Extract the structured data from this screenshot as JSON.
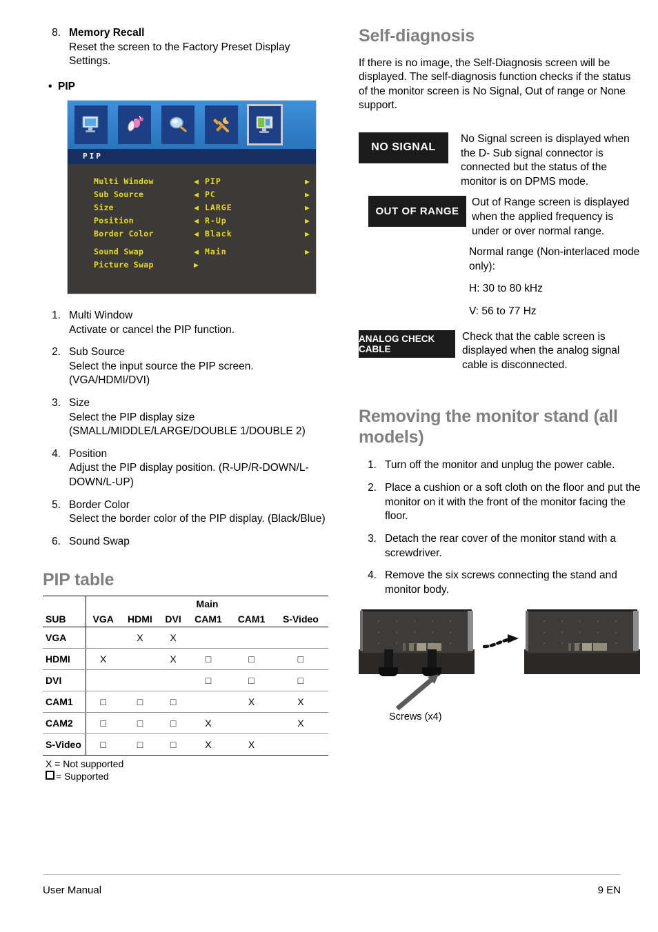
{
  "left_column": {
    "item8": {
      "number": "8.",
      "title": "Memory Recall",
      "desc": "Reset the screen to the Factory Preset Display Settings."
    },
    "bullet_pip": "PIP",
    "osd": {
      "menu_title": "PIP",
      "icons": [
        "display-monitor-icon",
        "color-paint-icon",
        "magnifier-icon",
        "wrench-tools-icon",
        "pip-picture-icon"
      ],
      "selected_icon_index": 4,
      "arrow_left": "◀",
      "arrow_right": "▶",
      "rows": [
        {
          "label": "Multi Window",
          "value": "PIP",
          "left_arrow": true,
          "right_arrow": true
        },
        {
          "label": "Sub Source",
          "value": "PC",
          "left_arrow": true,
          "right_arrow": true
        },
        {
          "label": "Size",
          "value": "LARGE",
          "left_arrow": true,
          "right_arrow": true
        },
        {
          "label": "Position",
          "value": "R-Up",
          "left_arrow": true,
          "right_arrow": true
        },
        {
          "label": "Border Color",
          "value": "Black",
          "left_arrow": true,
          "right_arrow": true
        },
        {
          "label": "Sound Swap",
          "value": "Main",
          "left_arrow": true,
          "right_arrow": true
        },
        {
          "label": "Picture Swap",
          "value": "",
          "left_arrow": false,
          "right_arrow": true
        }
      ],
      "colors": {
        "iconbar_blue": "#2f7fc9",
        "titlebar_blue": "#162f63",
        "body_gray": "#3b3a38",
        "text_yellow": "#e8dc18"
      }
    },
    "pip_items": [
      {
        "number": "1.",
        "title": "Multi Window",
        "desc": "Activate or cancel the PIP function."
      },
      {
        "number": "2.",
        "title": "Sub Source",
        "desc": "Select the input source the PIP screen. (VGA/HDMI/DVI)"
      },
      {
        "number": "3.",
        "title": "Size",
        "desc": "Select the PIP display size (SMALL/MIDDLE/LARGE/DOUBLE 1/DOUBLE 2)"
      },
      {
        "number": "4.",
        "title": "Position",
        "desc": "Adjust the PIP display position. (R-UP/R-DOWN/L-DOWN/L-UP)"
      },
      {
        "number": "5.",
        "title": "Border Color",
        "desc": "Select the border color of the PIP display. (Black/Blue)"
      },
      {
        "number": "6.",
        "title": "Sound Swap",
        "desc": ""
      }
    ],
    "pip_table": {
      "heading": "PIP table",
      "main_header": "Main",
      "corner_label": "SUB",
      "columns": [
        "VGA",
        "HDMI",
        "DVI",
        "CAM1",
        "CAM1",
        "S-Video"
      ],
      "rows": [
        {
          "label": "VGA",
          "cells": [
            "",
            "X",
            "X",
            "",
            "",
            ""
          ]
        },
        {
          "label": "HDMI",
          "cells": [
            "X",
            "",
            "X",
            "□",
            "□",
            "□"
          ]
        },
        {
          "label": "DVI",
          "cells": [
            "",
            "",
            "",
            "□",
            "□",
            "□"
          ]
        },
        {
          "label": "CAM1",
          "cells": [
            "□",
            "□",
            "□",
            "",
            "X",
            "X"
          ]
        },
        {
          "label": "CAM2",
          "cells": [
            "□",
            "□",
            "□",
            "X",
            "",
            "X"
          ]
        },
        {
          "label": "S-Video",
          "cells": [
            "□",
            "□",
            "□",
            "X",
            "X",
            ""
          ]
        }
      ],
      "legend_x": "X = Not supported",
      "legend_box": "= Supported"
    }
  },
  "right_column": {
    "self_diagnosis": {
      "heading": "Self-diagnosis",
      "intro": "If there is no image, the Self-Diagnosis screen will be displayed. The self-diagnosis function checks if the status of the monitor screen is No Signal, Out of range or None support.",
      "entries": [
        {
          "badge": "NO SIGNAL",
          "text": "No Signal screen is displayed when the D- Sub signal connector is connected but the status of the monitor is on DPMS mode."
        },
        {
          "badge": "OUT OF RANGE",
          "text": "Out of Range screen is displayed when the applied frequency is under or over normal range."
        }
      ],
      "range_note": "Normal range (Non-interlaced mode only):",
      "range_h": "H: 30 to 80 kHz",
      "range_v": "V: 56 to 77 Hz",
      "cable_entry": {
        "badge": "ANALOG CHECK CABLE",
        "text": "Check that the cable screen is displayed when the analog signal cable is disconnected."
      }
    },
    "removing_stand": {
      "heading": "Removing the monitor stand (all models)",
      "steps": [
        {
          "number": "1.",
          "text": "Turn off the monitor and unplug the power cable."
        },
        {
          "number": "2.",
          "text": "Place a cushion or a soft cloth on the floor and put the monitor on it with the front of the monitor facing the floor."
        },
        {
          "number": "3.",
          "text": "Detach the rear cover of the monitor stand with a screwdriver."
        },
        {
          "number": "4.",
          "text": "Remove the six screws connecting the stand and monitor body."
        }
      ],
      "figure_caption": "Screws (x4)"
    }
  },
  "footer": {
    "left": "User Manual",
    "right": "9 EN"
  }
}
